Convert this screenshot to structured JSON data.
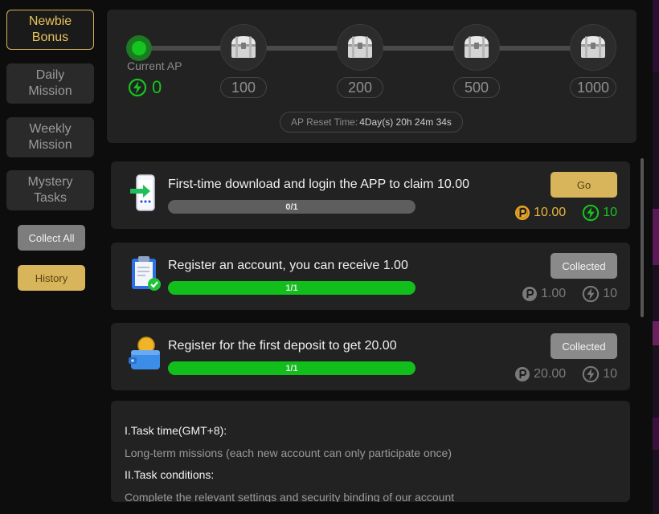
{
  "sidebar": {
    "tabs": [
      {
        "label_line1": "Newbie",
        "label_line2": "Bonus",
        "active": true
      },
      {
        "label_line1": "Daily",
        "label_line2": "Mission",
        "active": false
      },
      {
        "label_line1": "Weekly",
        "label_line2": "Mission",
        "active": false
      },
      {
        "label_line1": "Mystery",
        "label_line2": "Tasks",
        "active": false
      }
    ],
    "collect_all_label": "Collect All",
    "history_label": "History"
  },
  "ap_progress": {
    "current_ap_label": "Current AP",
    "current_ap_value": "0",
    "milestones": [
      "100",
      "200",
      "500",
      "1000"
    ],
    "reset_label": "AP Reset Time:",
    "reset_time": "4Day(s) 20h 24m 34s"
  },
  "tasks": [
    {
      "icon": "phone-download-icon",
      "title": "First-time download and login the APP to claim 10.00",
      "progress_text": "0/1",
      "progress_fraction": 0,
      "action_label": "Go",
      "action_state": "go",
      "coin_reward": "10.00",
      "ap_reward": "10"
    },
    {
      "icon": "clipboard-check-icon",
      "title": "Register an account, you can receive 1.00",
      "progress_text": "1/1",
      "progress_fraction": 1,
      "action_label": "Collected",
      "action_state": "collected",
      "coin_reward": "1.00",
      "ap_reward": "10"
    },
    {
      "icon": "wallet-coin-icon",
      "title": "Register for the first deposit to get 20.00",
      "progress_text": "1/1",
      "progress_fraction": 1,
      "action_label": "Collected",
      "action_state": "collected",
      "coin_reward": "20.00",
      "ap_reward": "10"
    }
  ],
  "rules": {
    "section1_title": "I.Task time(GMT+8):",
    "section1_body": "Long-term missions (each new account can only participate once)",
    "section2_title": "II.Task conditions:",
    "section2_body": "Complete the relevant settings and security binding of our account"
  },
  "colors": {
    "accent_gold": "#d8b45b",
    "ap_green": "#13c51e",
    "coin_gold": "#e8b53a"
  }
}
